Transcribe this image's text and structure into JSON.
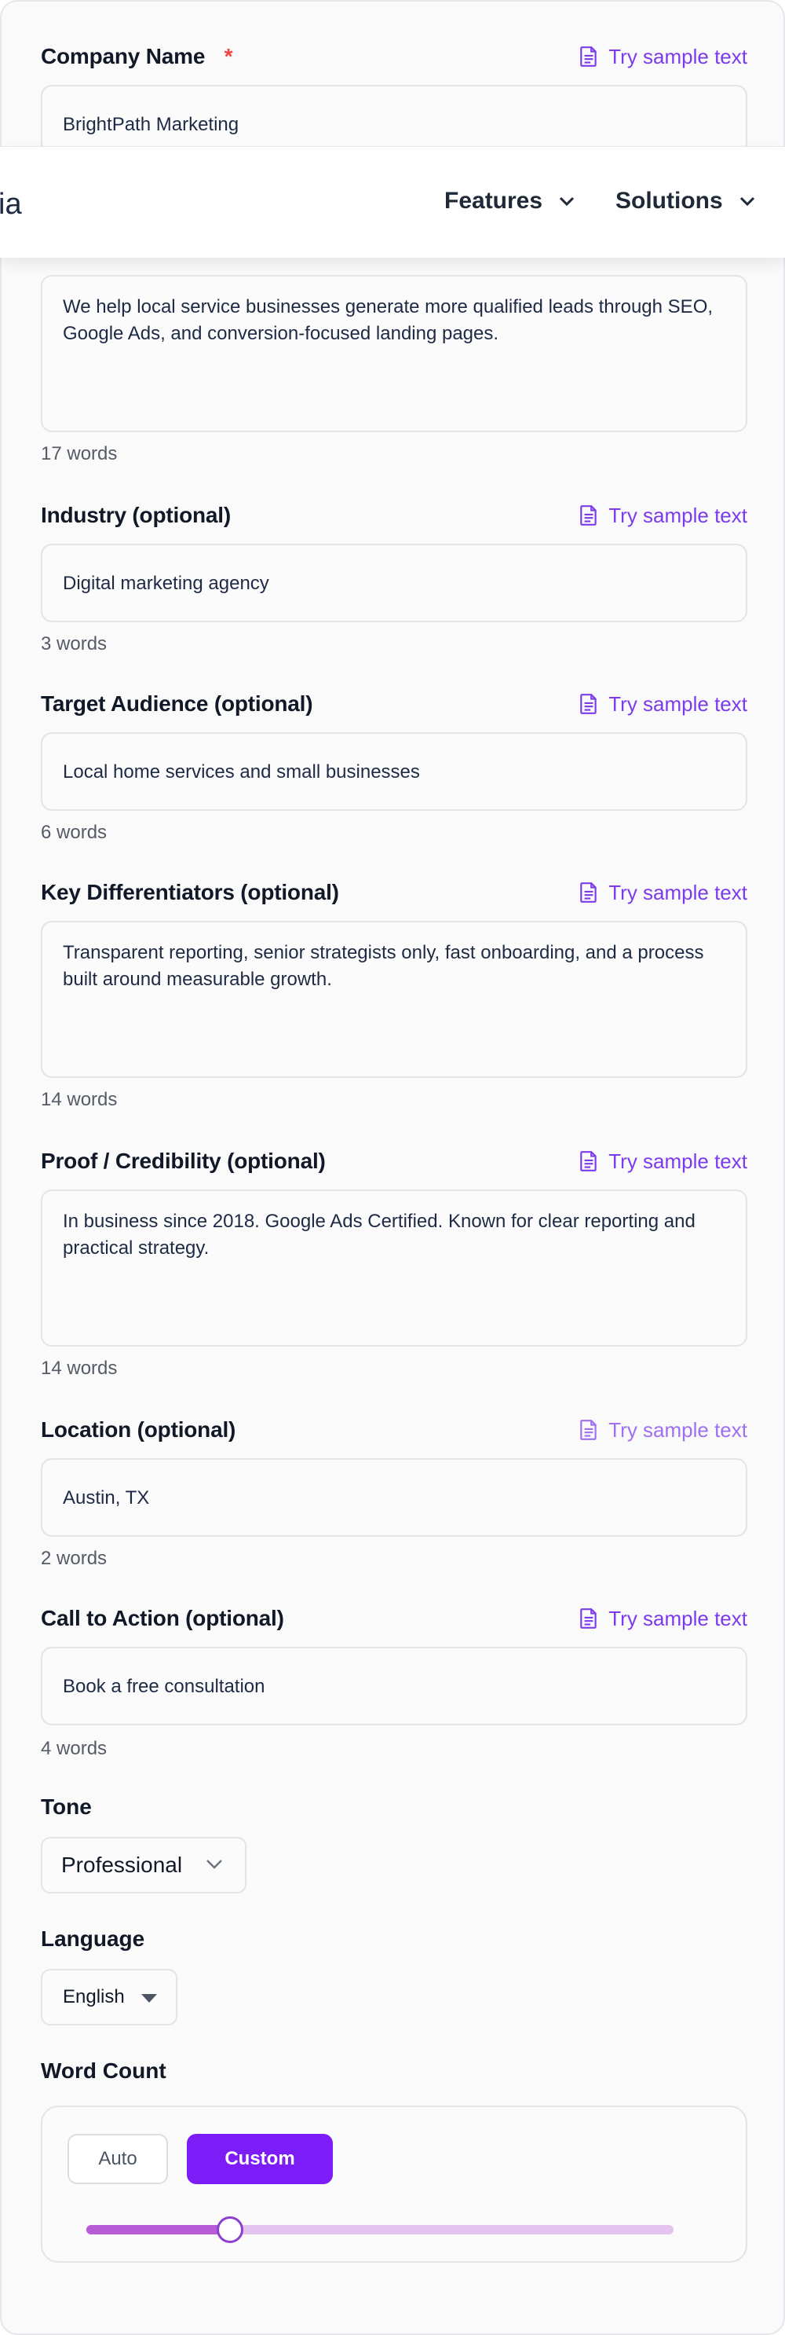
{
  "company": {
    "label": "Company Name",
    "required_mark": "*",
    "sample_label": "Try sample text",
    "value": "BrightPath Marketing"
  },
  "nav": {
    "logo_fragment": "ia",
    "items": [
      {
        "label": "Features"
      },
      {
        "label": "Solutions"
      }
    ]
  },
  "description": {
    "value": "We help local service businesses generate more qualified leads through SEO, Google Ads, and conversion-focused landing pages.",
    "count": "17 words"
  },
  "industry": {
    "label": "Industry (optional)",
    "sample_label": "Try sample text",
    "value": "Digital marketing agency",
    "count": "3 words"
  },
  "audience": {
    "label": "Target Audience (optional)",
    "sample_label": "Try sample text",
    "value": "Local home services and small businesses",
    "count": "6 words"
  },
  "differentiators": {
    "label": "Key Differentiators (optional)",
    "sample_label": "Try sample text",
    "value": "Transparent reporting, senior strategists only, fast onboarding, and a process built around measurable growth.",
    "count": "14 words"
  },
  "proof": {
    "label": "Proof / Credibility (optional)",
    "sample_label": "Try sample text",
    "value": "In business since 2018. Google Ads Certified. Known for clear reporting and practical strategy.",
    "count": "14 words"
  },
  "location": {
    "label": "Location (optional)",
    "sample_label": "Try sample text",
    "value": "Austin, TX",
    "count": "2 words"
  },
  "cta": {
    "label": "Call to Action (optional)",
    "sample_label": "Try sample text",
    "value": "Book a free consultation",
    "count": "4 words"
  },
  "tone": {
    "label": "Tone",
    "selected": "Professional"
  },
  "language": {
    "label": "Language",
    "selected": "English"
  },
  "word_count": {
    "label": "Word Count",
    "auto_label": "Auto",
    "custom_label": "Custom",
    "mode": "Custom",
    "slider_fraction": 0.245
  },
  "colors": {
    "accent": "#7c3aed",
    "button_primary": "#7c1cf7",
    "required": "#ef4444",
    "slider_fill": "#b75bd6",
    "slider_track": "#e4c3ef"
  },
  "icons": {
    "sample": "document-icon",
    "nav_chevron": "chevron-down-icon",
    "tone_chevron": "chevron-down-icon",
    "language_caret": "caret-down-icon"
  }
}
